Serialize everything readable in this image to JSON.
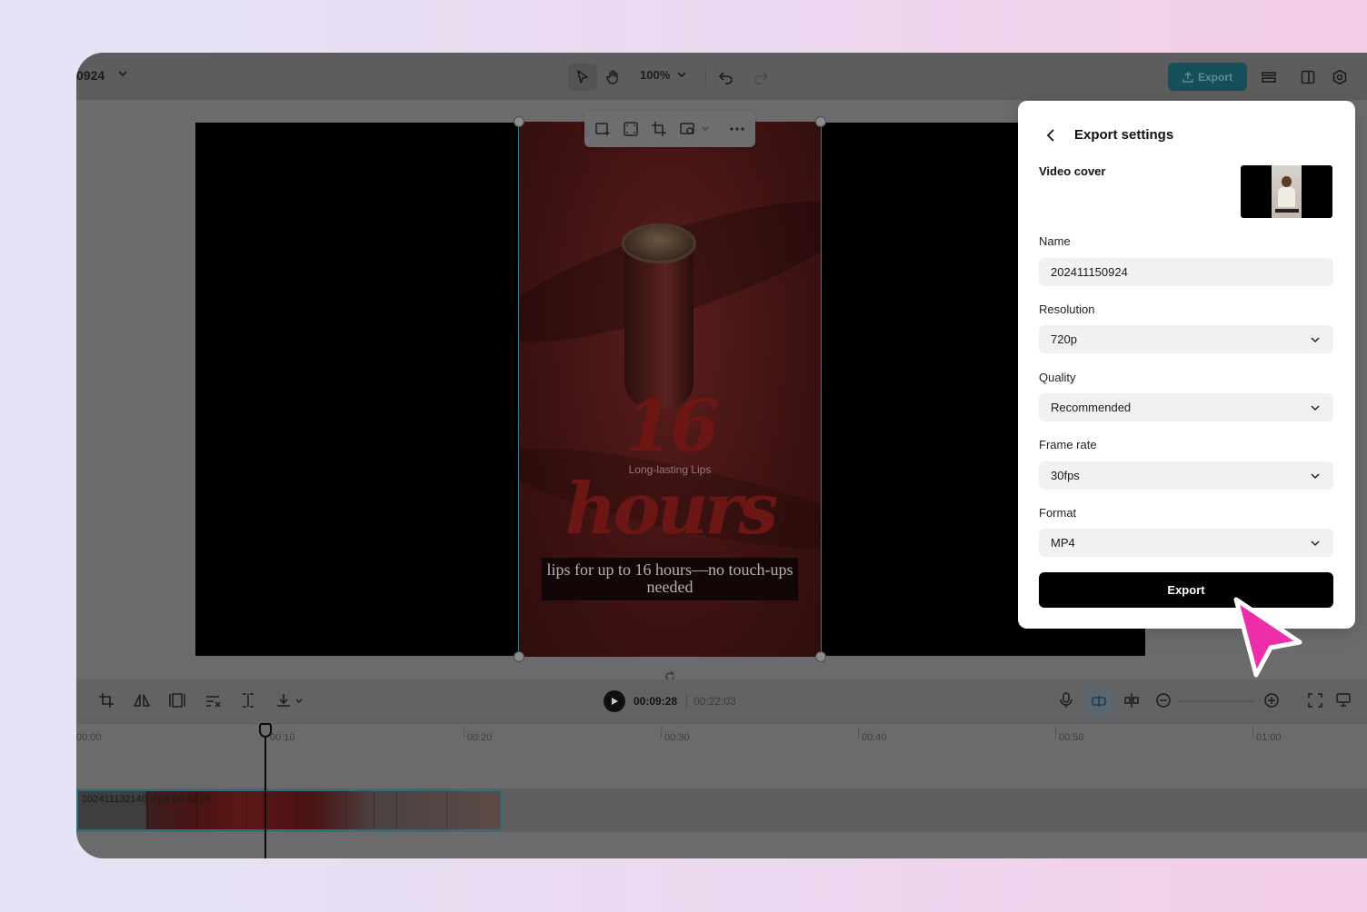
{
  "topbar": {
    "project_name": "0924",
    "zoom_level": "100%",
    "export_label": "Export"
  },
  "canvas": {
    "video_title": "16 hours",
    "video_subtitle": "Long-lasting Lips",
    "caption": "lips for up to 16 hours—no touch-ups needed"
  },
  "playback": {
    "current_time": "00:09:28",
    "total_time": "00:22:03"
  },
  "timeline": {
    "ticks": [
      "00:00",
      "00:10",
      "00:20",
      "00:30",
      "00:40",
      "00:50",
      "01:00"
    ],
    "clip_label": "20241113214б.mp4   00:22:03"
  },
  "export_panel": {
    "title": "Export settings",
    "video_cover_label": "Video cover",
    "name_label": "Name",
    "name_value": "202411150924",
    "resolution_label": "Resolution",
    "resolution_value": "720p",
    "quality_label": "Quality",
    "quality_value": "Recommended",
    "frame_rate_label": "Frame rate",
    "frame_rate_value": "30fps",
    "format_label": "Format",
    "format_value": "MP4",
    "export_button": "Export"
  },
  "colors": {
    "accent_teal": "#15505a",
    "cursor_pink": "#ec2fa8",
    "panel_field_bg": "#eff1f3"
  }
}
